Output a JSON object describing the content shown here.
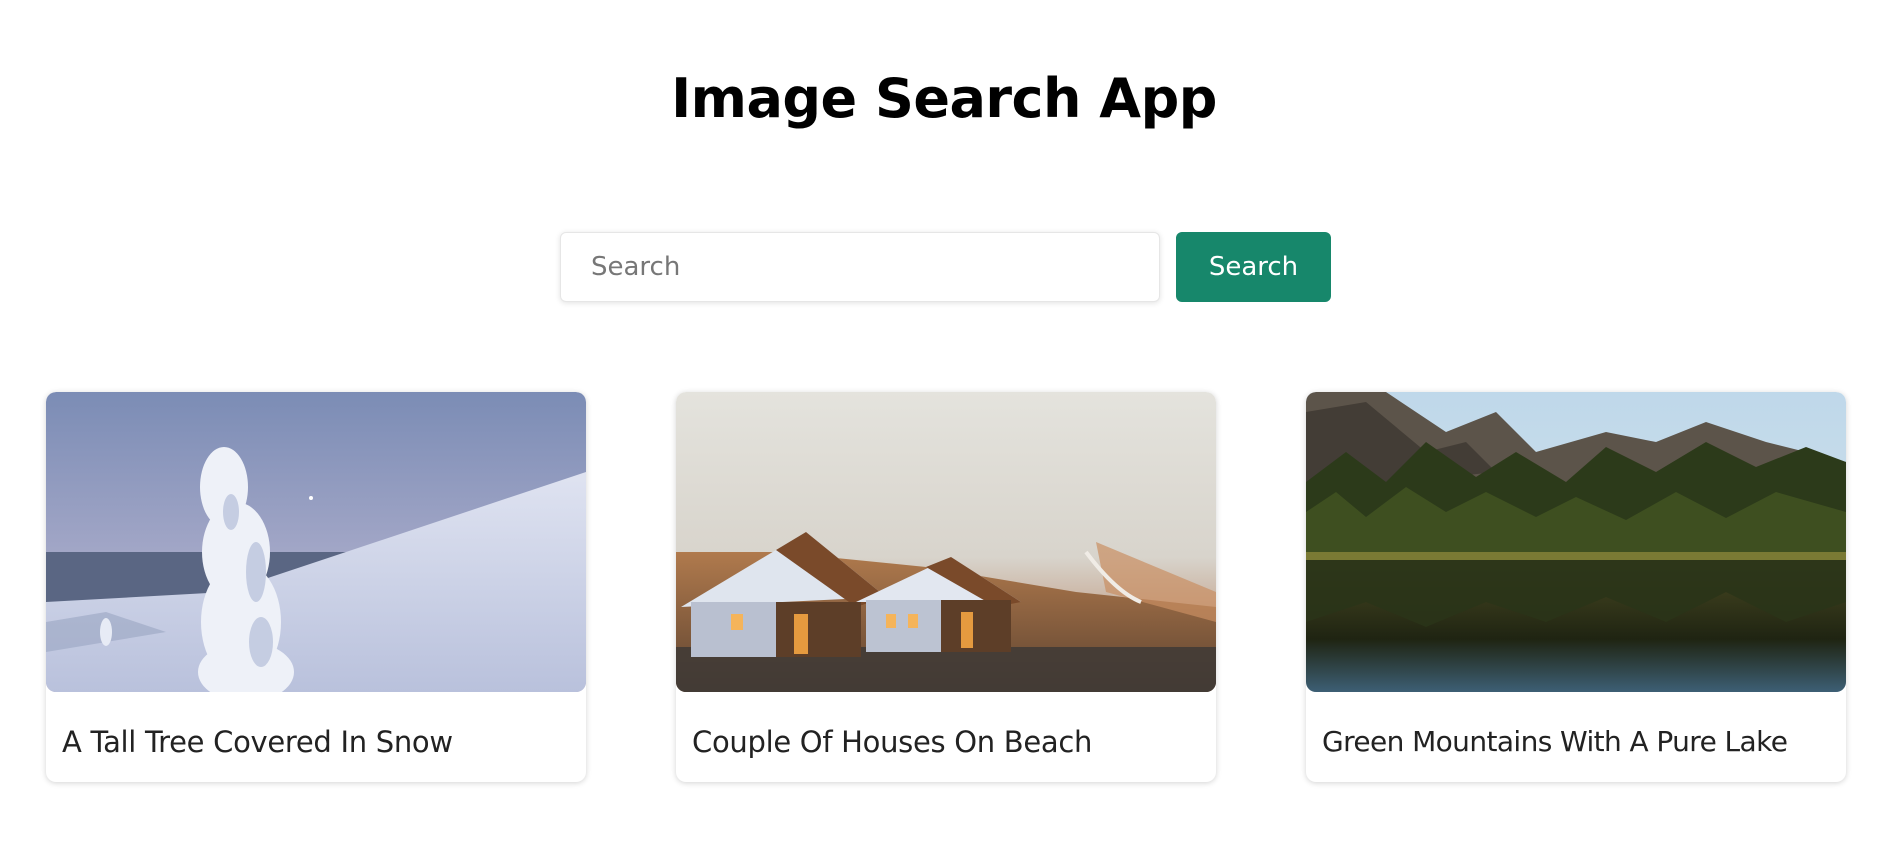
{
  "header": {
    "title": "Image Search App"
  },
  "search": {
    "placeholder": "Search",
    "value": "",
    "button_label": "Search"
  },
  "colors": {
    "accent": "#17876b",
    "background": "#ffffff",
    "text": "#000000"
  },
  "results": [
    {
      "caption": "A Tall Tree Covered In Snow",
      "image_subject": "snow-covered-tree-photo"
    },
    {
      "caption": "Couple Of Houses On Beach",
      "image_subject": "houses-on-beach-photo"
    },
    {
      "caption": "Green Mountains With A Pure Lake",
      "image_subject": "mountains-lake-photo"
    }
  ]
}
